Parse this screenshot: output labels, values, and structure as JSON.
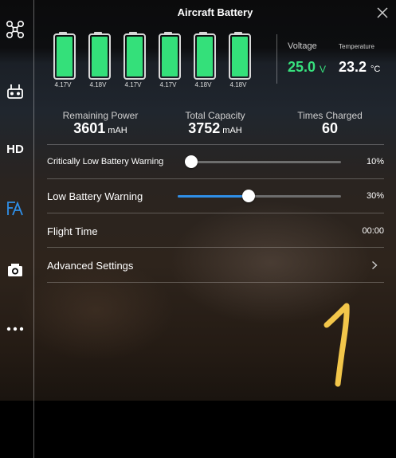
{
  "window": {
    "title": "Aircraft Battery"
  },
  "colors": {
    "accent_green": "#37e07d",
    "cell_fill": "#34e07a",
    "slider_blue": "#2f8fe8",
    "handwriting_yellow": "#f2c64a"
  },
  "sidebar": {
    "items": [
      {
        "name": "aircraft-icon",
        "label": ""
      },
      {
        "name": "remote-controller-icon",
        "label": ""
      },
      {
        "name": "hd-video",
        "label": "HD"
      },
      {
        "name": "battery-settings-icon",
        "label": ""
      },
      {
        "name": "camera-icon",
        "label": ""
      },
      {
        "name": "more-icon",
        "label": ""
      }
    ]
  },
  "cells": [
    {
      "voltage": "4.17V",
      "level": 1
    },
    {
      "voltage": "4.18V",
      "level": 1
    },
    {
      "voltage": "4.17V",
      "level": 1
    },
    {
      "voltage": "4.17V",
      "level": 1
    },
    {
      "voltage": "4.18V",
      "level": 1
    },
    {
      "voltage": "4.18V",
      "level": 1
    }
  ],
  "voltage": {
    "label": "Voltage",
    "value": "25.0",
    "unit": "V"
  },
  "temperature": {
    "label": "Temperature",
    "value": "23.2",
    "unit": "°C"
  },
  "stats": {
    "remaining": {
      "label": "Remaining Power",
      "value": "3601",
      "unit": "mAH"
    },
    "capacity": {
      "label": "Total Capacity",
      "value": "3752",
      "unit": "mAH"
    },
    "charged": {
      "label": "Times Charged",
      "value": "60"
    }
  },
  "settings": {
    "critical": {
      "label": "Critically Low Battery Warning",
      "value": "10%",
      "level": 0.1
    },
    "low": {
      "label": "Low Battery Warning",
      "value": "30%",
      "level": 0.3
    },
    "flight_time": {
      "label": "Flight Time",
      "value": "00:00"
    },
    "advanced": {
      "label": "Advanced Settings"
    }
  },
  "annotation": {
    "handwritten": "1"
  }
}
